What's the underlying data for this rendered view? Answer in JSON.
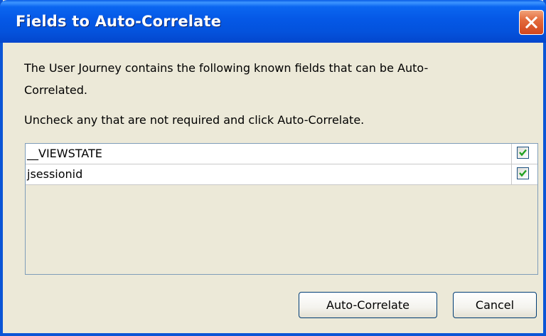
{
  "dialog": {
    "title": "Fields to Auto-Correlate",
    "description": "The User Journey contains the following known fields that can be Auto-Correlated.",
    "instruction": "Uncheck any that are not required and click Auto-Correlate."
  },
  "fields": [
    {
      "name": "__VIEWSTATE",
      "checked": true
    },
    {
      "name": "jsessionid",
      "checked": true
    }
  ],
  "buttons": {
    "auto_correlate_label": "Auto-Correlate",
    "cancel_label": "Cancel"
  },
  "colors": {
    "titlebar": "#0558e6",
    "dialog_background": "#ece9d8",
    "close_button": "#e36b3c",
    "checkmark": "#21a121"
  }
}
